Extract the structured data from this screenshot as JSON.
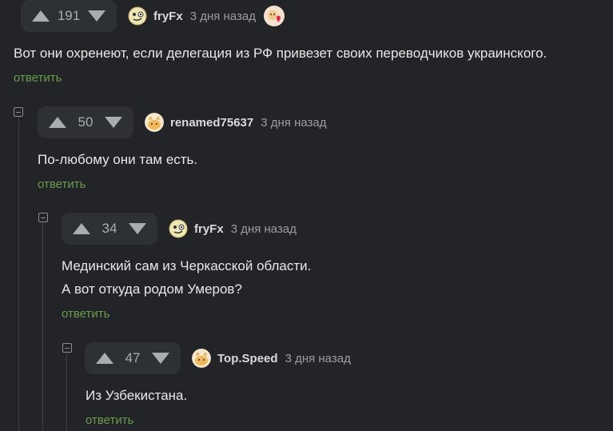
{
  "comments": [
    {
      "rating": "191",
      "author": "fryFx",
      "time": "3 дня назад",
      "text": [
        "Вот они охренеют, если делегация из РФ привезет своих переводчиков украинского."
      ],
      "reply_label": "ответить",
      "avatar_icon": "smiley-face-icon",
      "badge_icon": "heart-award-icon"
    },
    {
      "rating": "50",
      "author": "renamed75637",
      "time": "3 дня назад",
      "text": [
        "По-любому они там есть."
      ],
      "reply_label": "ответить",
      "avatar_icon": "cat-face-icon"
    },
    {
      "rating": "34",
      "author": "fryFx",
      "time": "3 дня назад",
      "text": [
        "Мединский сам из Черкасской области.",
        "А вот откуда родом Умеров?"
      ],
      "reply_label": "ответить",
      "avatar_icon": "smiley-face-icon"
    },
    {
      "rating": "47",
      "author": "Top.Speed",
      "time": "3 дня назад",
      "text": [
        "Из Узбекистана."
      ],
      "reply_label": "ответить",
      "avatar_icon": "cat-face-icon"
    }
  ],
  "colors": {
    "background": "#222427",
    "vote_bg": "#2d3034",
    "reply": "#6a9c4e",
    "muted": "#9a9ea3"
  }
}
